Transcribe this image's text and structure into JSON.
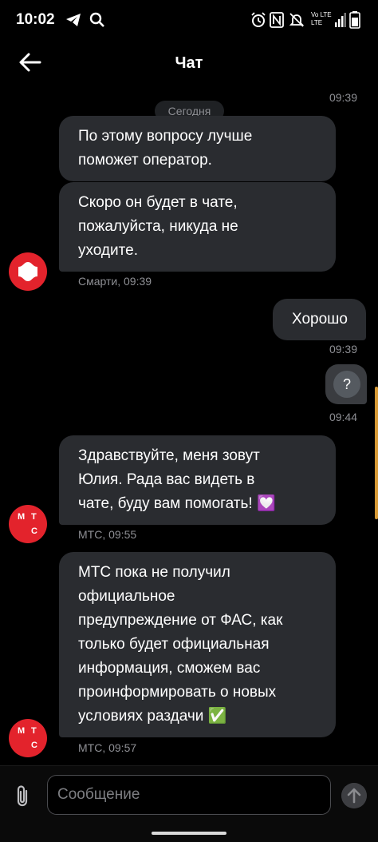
{
  "status_bar": {
    "time": "10:02",
    "left_icons": [
      "telegram-icon",
      "search-icon"
    ],
    "right_icons": [
      "alarm-icon",
      "nfc-icon",
      "mute-icon",
      "volte-lte-icon",
      "signal-icon",
      "battery-icon"
    ],
    "network_label_top": "Vo LTE",
    "network_label_bottom": "LTE"
  },
  "header": {
    "title": "Чат",
    "back_icon": "arrow-left-icon"
  },
  "chat": {
    "date_label": "Сегодня",
    "time_top": "09:39",
    "messages": [
      {
        "side": "in",
        "text_lines": [
          "По этому вопросу лучше",
          "поможет оператор."
        ]
      },
      {
        "side": "in",
        "text_lines": [
          "Скоро он будет в чате,",
          "пожалуйста, никуда не",
          "уходите."
        ],
        "sender": "Смарти, 09:39",
        "avatar": "smarti-logo"
      },
      {
        "side": "out",
        "text_lines": [
          "Хорошо"
        ],
        "time": "09:39"
      },
      {
        "side": "out",
        "attachment": "question-icon",
        "attachment_glyph": "?",
        "time": "09:44"
      },
      {
        "side": "in",
        "text_lines": [
          "Здравствуйте, меня зовут",
          "Юлия. Рада вас видеть в",
          "чате, буду вам помогать! 💟"
        ],
        "sender": "МТС, 09:55",
        "avatar": "mts-logo"
      },
      {
        "side": "in",
        "text_lines": [
          "МТС пока не получил",
          "официальное",
          "предупреждение от ФАС, как",
          "только будет официальная",
          "информация, сможем вас",
          "проинформировать о новых",
          "условиях раздачи ✅"
        ],
        "sender": "МТС, 09:57",
        "avatar": "mts-logo"
      }
    ],
    "mts_logo_letters": [
      "М",
      "Т",
      "С"
    ]
  },
  "composer": {
    "placeholder": "Сообщение",
    "attach_icon": "paperclip-icon",
    "send_icon": "send-arrow-up-icon"
  },
  "colors": {
    "background": "#000000",
    "bubble": "#2a2c30",
    "meta_text": "#8e8f94",
    "mts_red": "#e3232c",
    "scroll_accent": "#d79a35"
  }
}
